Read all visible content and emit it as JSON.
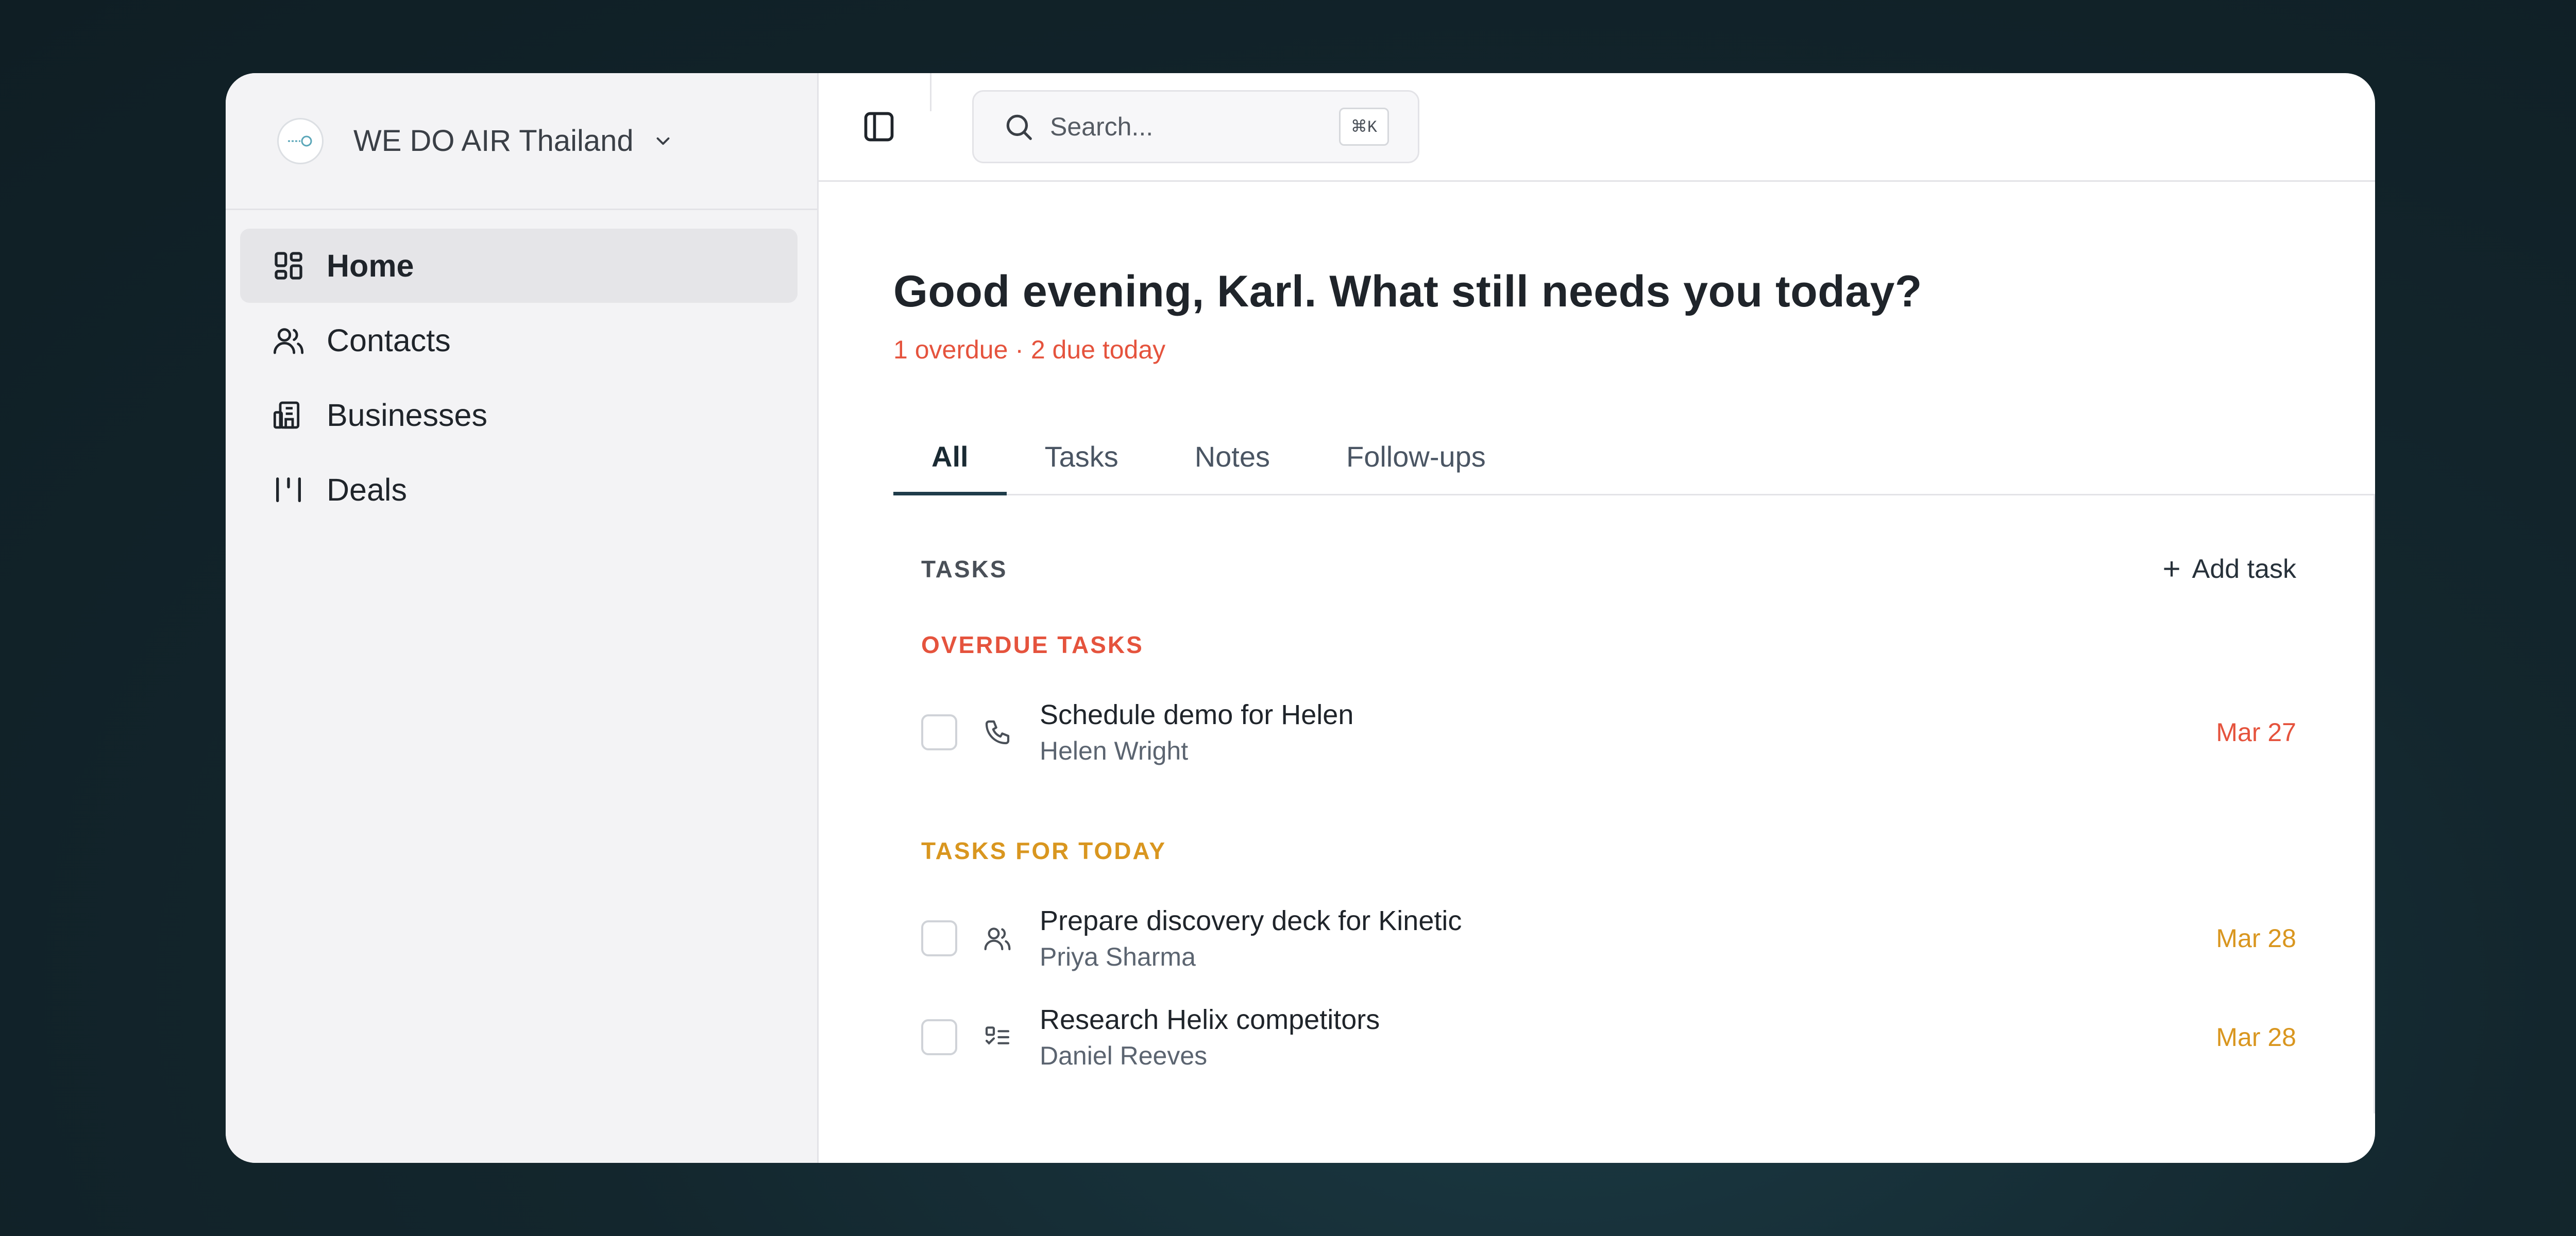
{
  "workspace": {
    "name": "WE DO AIR Thailand",
    "logo_icon": "workspace-logo",
    "chevron_icon": "chevron-down-icon"
  },
  "sidebar": {
    "items": [
      {
        "label": "Home",
        "icon": "dashboard-grid-icon",
        "active": true
      },
      {
        "label": "Contacts",
        "icon": "users-icon",
        "active": false
      },
      {
        "label": "Businesses",
        "icon": "building-icon",
        "active": false
      },
      {
        "label": "Deals",
        "icon": "kanban-icon",
        "active": false
      }
    ]
  },
  "topbar": {
    "search_placeholder": "Search...",
    "search_shortcut": "⌘K"
  },
  "main": {
    "greeting": "Good evening, Karl. What still needs you today?",
    "summary": "1 overdue · 2 due today",
    "tabs": [
      {
        "label": "All",
        "active": true
      },
      {
        "label": "Tasks",
        "active": false
      },
      {
        "label": "Notes",
        "active": false
      },
      {
        "label": "Follow-ups",
        "active": false
      }
    ]
  },
  "tasks": {
    "section_title": "TASKS",
    "add_label": "Add task",
    "overdue_label": "OVERDUE TASKS",
    "today_label": "TASKS FOR TODAY",
    "overdue": [
      {
        "title": "Schedule demo for Helen",
        "contact": "Helen Wright",
        "date": "Mar 27",
        "icon": "phone-icon"
      }
    ],
    "today": [
      {
        "title": "Prepare discovery deck for Kinetic",
        "contact": "Priya Sharma",
        "date": "Mar 28",
        "icon": "users-icon"
      },
      {
        "title": "Research Helix competitors",
        "contact": "Daniel Reeves",
        "date": "Mar 28",
        "icon": "checklist-icon"
      }
    ]
  },
  "colors": {
    "overdue": "#e5533d",
    "today": "#d9961f",
    "accent": "#1f3c4a"
  }
}
